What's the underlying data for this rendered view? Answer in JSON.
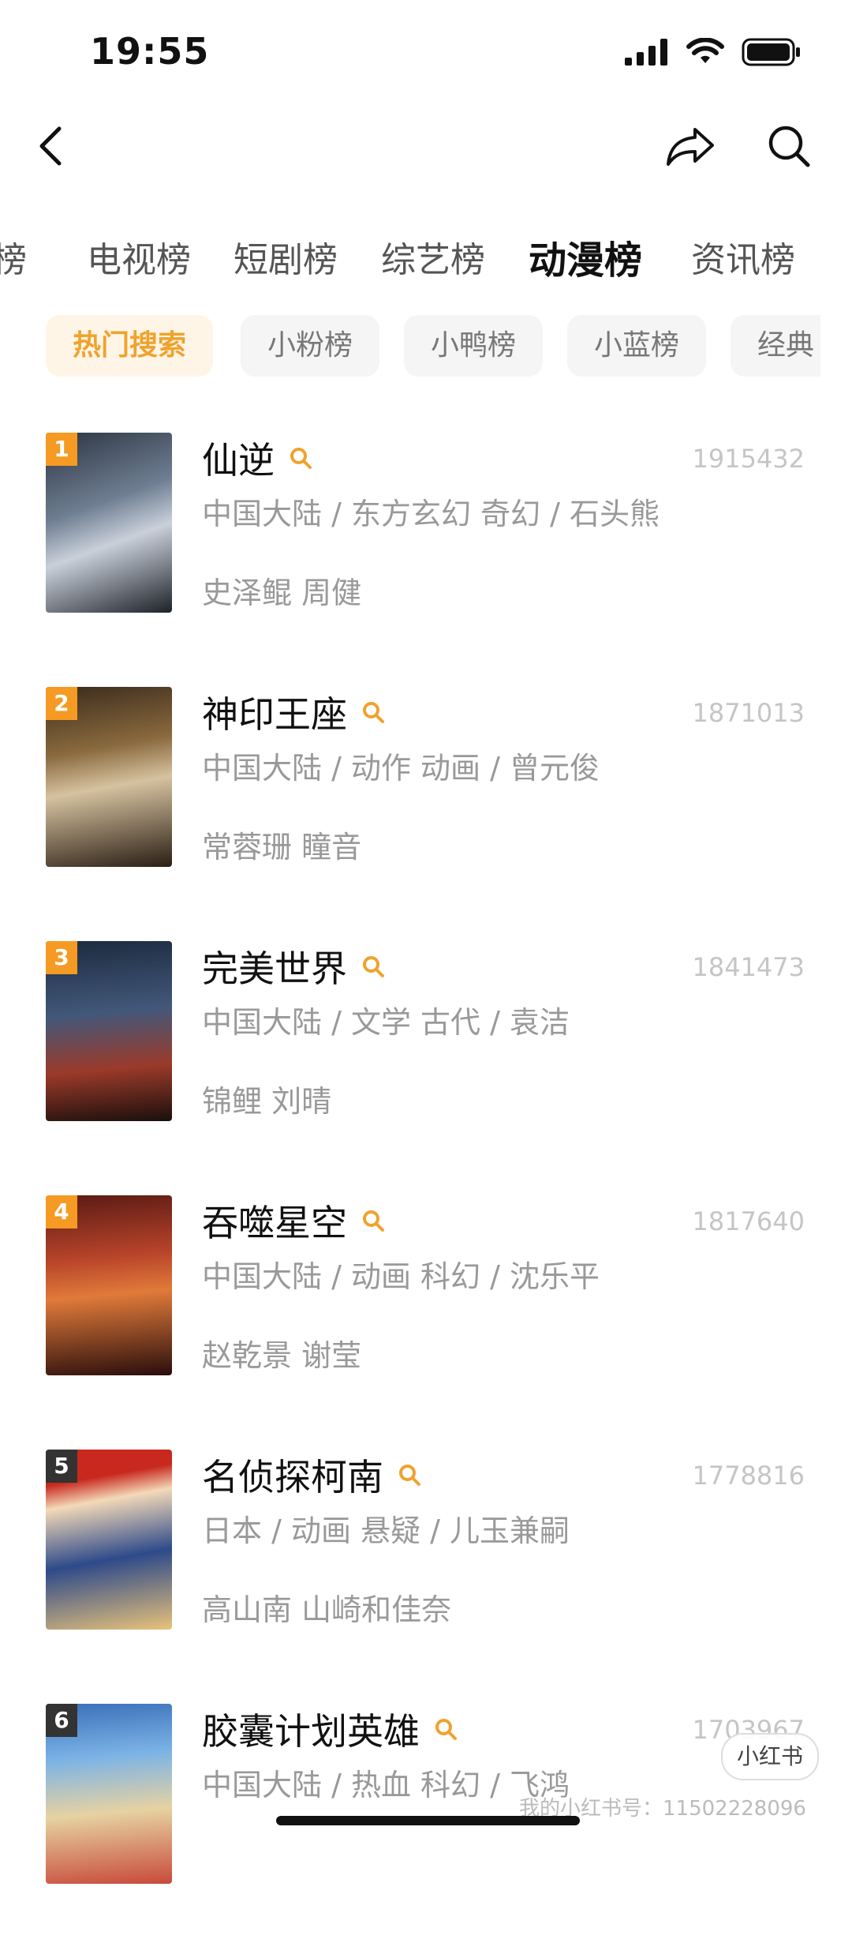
{
  "status": {
    "time": "19:55"
  },
  "tabs": [
    "榜",
    "电视榜",
    "短剧榜",
    "综艺榜",
    "动漫榜",
    "资讯榜"
  ],
  "active_tab": "动漫榜",
  "chips": [
    "热门搜索",
    "小粉榜",
    "小鸭榜",
    "小蓝榜",
    "经典"
  ],
  "items": [
    {
      "rank": "1",
      "title": "仙逆",
      "count": "1915432",
      "meta": "中国大陆 / 东方玄幻 奇幻 / 石头熊",
      "cast": "史泽鲲 周健"
    },
    {
      "rank": "2",
      "title": "神印王座",
      "count": "1871013",
      "meta": "中国大陆 / 动作 动画 / 曾元俊",
      "cast": "常蓉珊 瞳音"
    },
    {
      "rank": "3",
      "title": "完美世界",
      "count": "1841473",
      "meta": "中国大陆 / 文学 古代 / 袁洁",
      "cast": "锦鲤 刘晴"
    },
    {
      "rank": "4",
      "title": "吞噬星空",
      "count": "1817640",
      "meta": "中国大陆 / 动画 科幻 / 沈乐平",
      "cast": "赵乾景 谢莹"
    },
    {
      "rank": "5",
      "title": "名侦探柯南",
      "count": "1778816",
      "meta": "日本 / 动画 悬疑 / 儿玉兼嗣",
      "cast": "高山南 山崎和佳奈"
    },
    {
      "rank": "6",
      "title": "胶囊计划英雄",
      "count": "1703967",
      "meta": "中国大陆 / 热血 科幻 / 飞鸿",
      "cast": ""
    }
  ],
  "overlay": {
    "badge": "小红书",
    "watermark": "我的小红书号：11502228096"
  },
  "colors": {
    "accent": "#f0a22e",
    "chip_active_bg": "#fff5e6",
    "rank_1_4": "#f59a23",
    "rank_5_6": "#333333"
  }
}
